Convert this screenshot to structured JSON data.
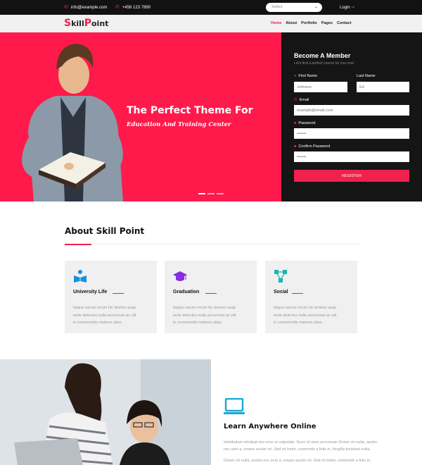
{
  "topbar": {
    "email": "info@example.com",
    "phone": "+456 123 7890",
    "select_value": "Select",
    "login": "Login"
  },
  "nav": {
    "logo_first": "S",
    "logo_mid": "kill",
    "logo_p": "P",
    "logo_rest": "oint",
    "menu": [
      "Home",
      "About",
      "Portfolio",
      "Pages",
      "Contact"
    ]
  },
  "hero": {
    "title": "The Perfect Theme For",
    "subtitle": "Education And Training Center"
  },
  "member": {
    "title": "Become A Member",
    "subtitle": "Let's find a perfect course for you now!",
    "first_name_label": "First Name",
    "last_name_label": "Last Name",
    "first_name_value": "Johnson",
    "last_name_value": "Ed",
    "email_label": "Email",
    "email_value": "example@email.com",
    "password_label": "Password",
    "password_value": "•••••••",
    "confirm_label": "Confirm Password",
    "confirm_value": "•••••••",
    "register": "REGISTER"
  },
  "about": {
    "title": "About Skill Point",
    "cards": [
      {
        "title": "University Life",
        "icon": "book-reader-icon",
        "color": "#1a8fe0",
        "line1": "Itaque earum rerum hic tenetur asap",
        "line2": "iente delectus nulla accumsan ac elit",
        "line3": "in consciendis maiores alias."
      },
      {
        "title": "Graduation",
        "icon": "graduation-cap-icon",
        "color": "#8a2be2",
        "line1": "Itaque earum rerum hic tenetur asap",
        "line2": "iente delectus nulla accumsan ac elit",
        "line3": "in consciendis maiores alias."
      },
      {
        "title": "Social",
        "icon": "network-icon",
        "color": "#17b5b5",
        "line1": "Itaque earum rerum hic tenetur asap",
        "line2": "iente delectus nulla accumsan ac elit",
        "line3": "in consciendis maiores alias."
      }
    ]
  },
  "learn": {
    "title": "Learn Anywhere Online",
    "p1_line1": "Vestibulum volutpat non eros ut vulputate. Nunc id risus accumsan Donec mi nulla, auctor",
    "p1_line2": "nec sem a, ornare auctor mi. Sed mi tortor, commodo a felis in, fringilla tincidunt nulla.",
    "p2_line1": "Donec mi nulla, auctor nec sem a, ornare auctor mi. Sed mi tortor, commodo a felis in,"
  },
  "colors": {
    "accent": "#f0204f",
    "hero_bg": "#ff1a4b",
    "dark": "#151515"
  }
}
